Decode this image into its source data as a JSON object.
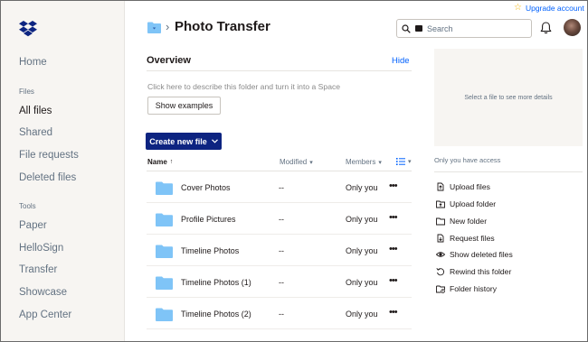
{
  "header": {
    "title": "Photo Transfer",
    "breadcrumb_separator": "›",
    "upgrade_label": "Upgrade account",
    "search_placeholder": "Search"
  },
  "sidebar": {
    "home": "Home",
    "files_section": "Files",
    "files_items": [
      "All files",
      "Shared",
      "File requests",
      "Deleted files"
    ],
    "tools_section": "Tools",
    "tools_items": [
      "Paper",
      "HelloSign",
      "Transfer",
      "Showcase",
      "App Center"
    ]
  },
  "overview": {
    "title": "Overview",
    "hide_label": "Hide",
    "description_placeholder": "Click here to describe this folder and turn it into a Space",
    "show_examples_label": "Show examples"
  },
  "create_button_label": "Create new file",
  "table": {
    "columns": [
      "Name",
      "Modified",
      "Members"
    ],
    "rows": [
      {
        "name": "Cover Photos",
        "modified": "--",
        "members": "Only you"
      },
      {
        "name": "Profile Pictures",
        "modified": "--",
        "members": "Only you"
      },
      {
        "name": "Timeline Photos",
        "modified": "--",
        "members": "Only you"
      },
      {
        "name": "Timeline Photos (1)",
        "modified": "--",
        "members": "Only you"
      },
      {
        "name": "Timeline Photos (2)",
        "modified": "--",
        "members": "Only you"
      }
    ]
  },
  "details": {
    "preview_text": "Select a file to see more details",
    "access_text": "Only you have access",
    "actions": [
      {
        "label": "Upload files",
        "icon": "upload-files-icon"
      },
      {
        "label": "Upload folder",
        "icon": "upload-folder-icon"
      },
      {
        "label": "New folder",
        "icon": "new-folder-icon"
      },
      {
        "label": "Request files",
        "icon": "request-files-icon"
      },
      {
        "label": "Show deleted files",
        "icon": "eye-icon"
      },
      {
        "label": "Rewind this folder",
        "icon": "rewind-icon"
      },
      {
        "label": "Folder history",
        "icon": "folder-history-icon"
      }
    ]
  },
  "colors": {
    "accent_blue": "#0061fe",
    "create_button": "#0d2481",
    "folder_blue": "#7fc4f7",
    "sidebar_bg": "#f7f5f2"
  }
}
